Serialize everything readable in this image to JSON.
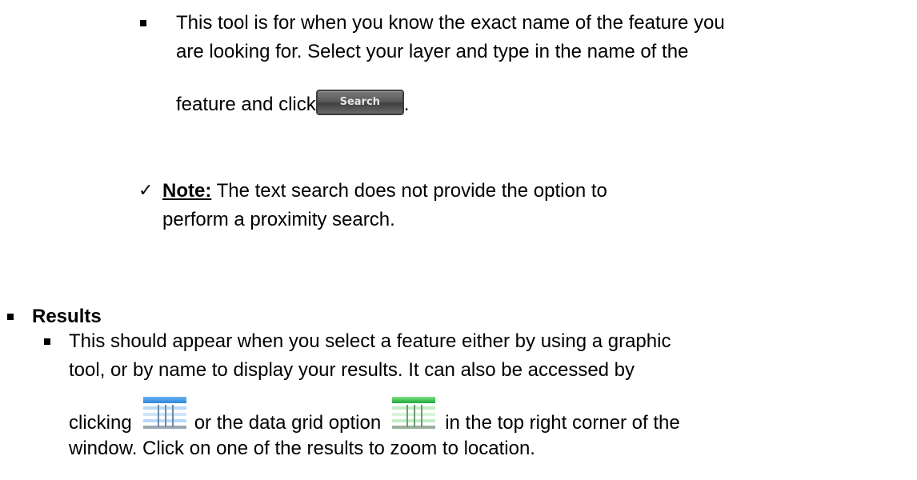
{
  "text_search": {
    "desc_line1": "This tool is for when you know the exact name of the feature you",
    "desc_line2": "are looking for. Select your layer and type in the name of the",
    "desc_line3_prefix": "feature and click",
    "desc_line3_suffix": ".",
    "search_button_label": "Search"
  },
  "note": {
    "label": "Note:",
    "line1_rest": " The text search does not provide the option to",
    "line2": "perform a proximity search."
  },
  "results": {
    "heading": "Results",
    "line1": "This should appear when you select a feature either by using a graphic",
    "line2": "tool, or by name to display your results. It can also be accessed by",
    "line3_prefix": "clicking",
    "line3_middle": "or the data grid option",
    "line3_suffix": "in the top right corner of the",
    "line4": "window. Click on one of the results to zoom to location.",
    "icons": [
      "results-table-icon",
      "data-grid-icon"
    ],
    "icon_colors": {
      "results": "#3a8fe0",
      "data_grid": "#22b84a"
    }
  }
}
